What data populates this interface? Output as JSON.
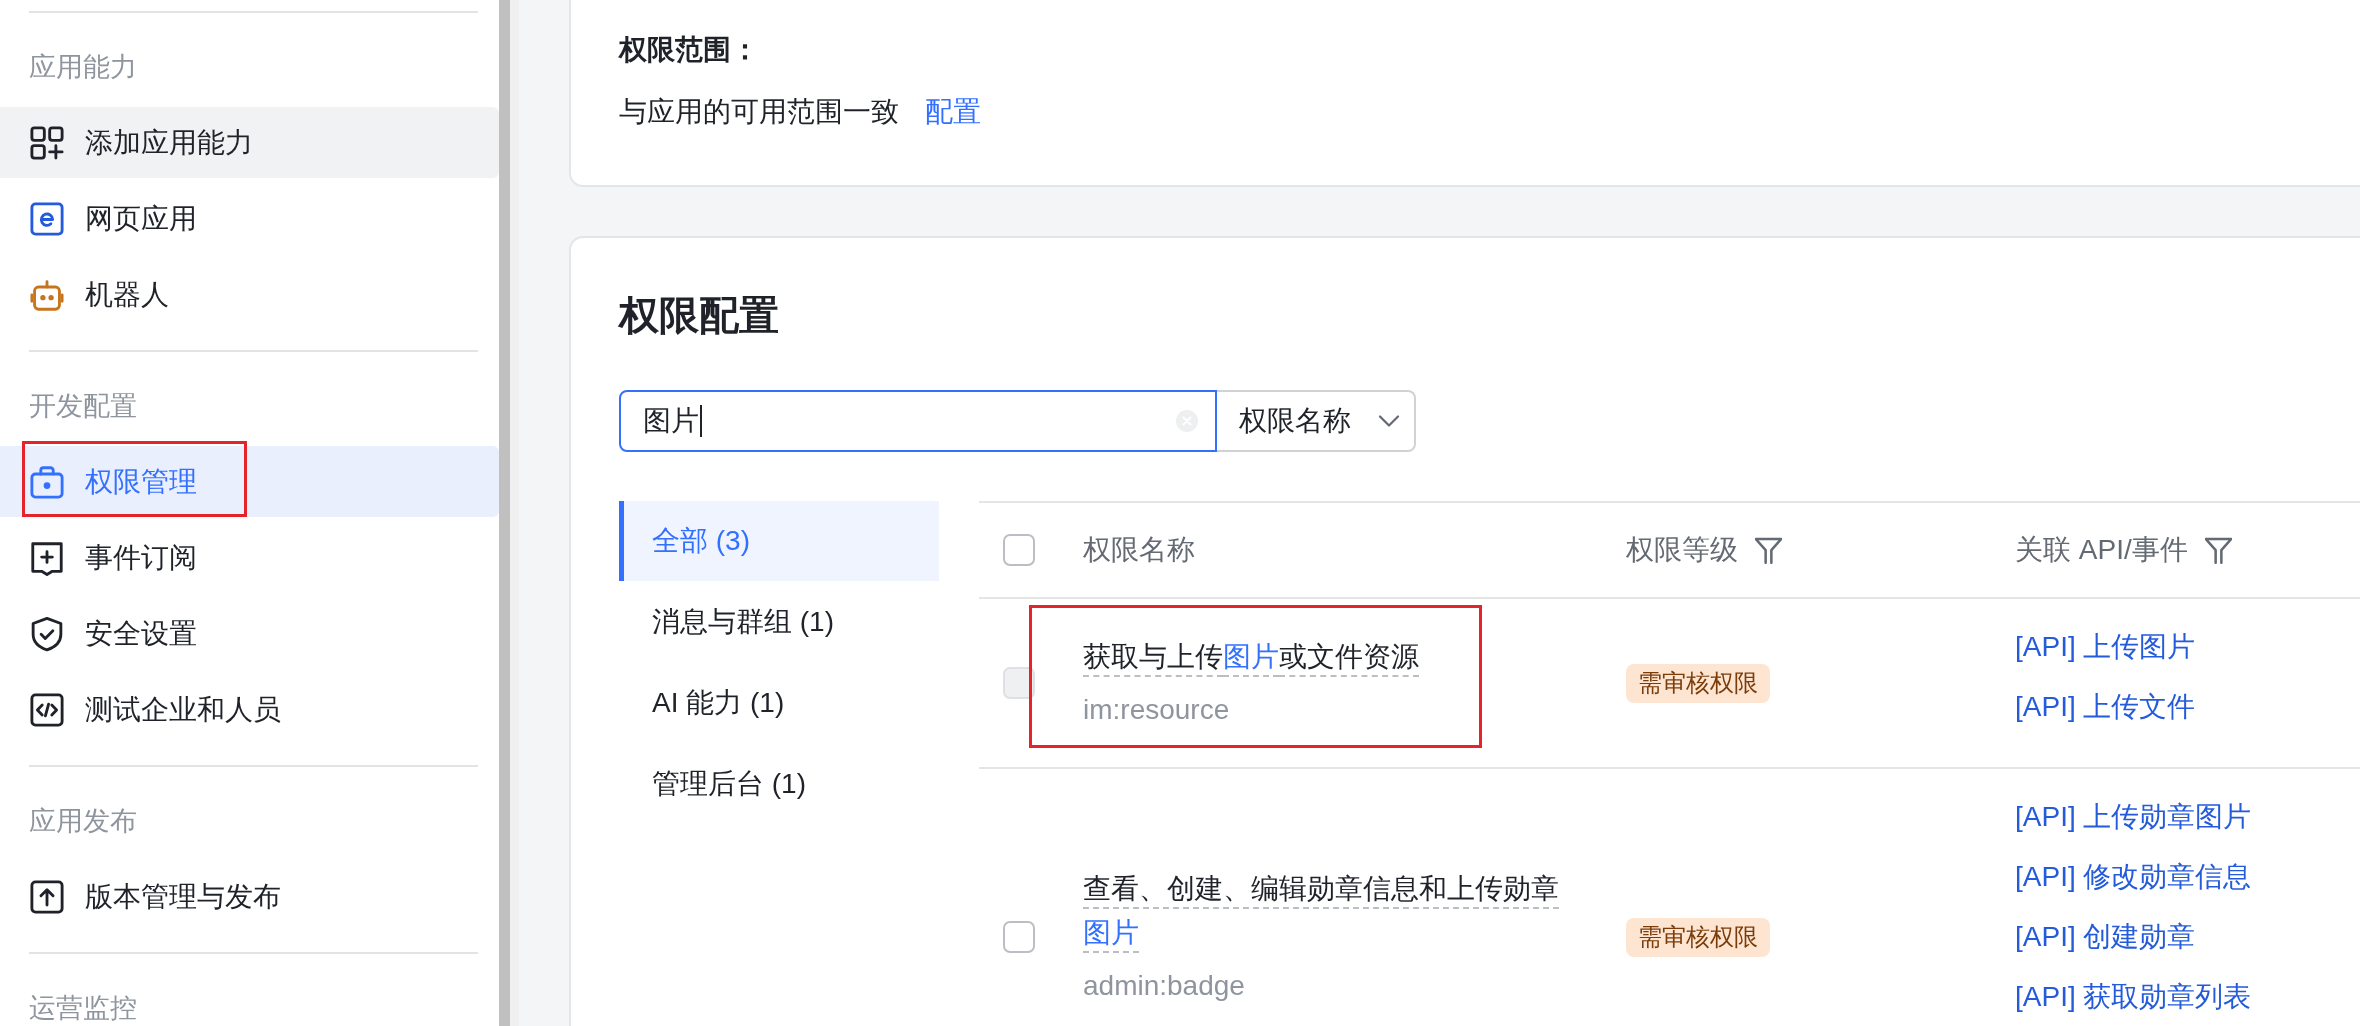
{
  "sidebar": {
    "sections": [
      {
        "title": "应用能力",
        "items": [
          {
            "label": "添加应用能力",
            "selected": false,
            "hovered": true,
            "annotated": false
          },
          {
            "label": "网页应用",
            "selected": false,
            "hovered": false,
            "annotated": false
          },
          {
            "label": "机器人",
            "selected": false,
            "hovered": false,
            "annotated": false
          }
        ]
      },
      {
        "title": "开发配置",
        "items": [
          {
            "label": "权限管理",
            "selected": true,
            "hovered": false,
            "annotated": true
          },
          {
            "label": "事件订阅",
            "selected": false,
            "hovered": false,
            "annotated": false
          },
          {
            "label": "安全设置",
            "selected": false,
            "hovered": false,
            "annotated": false
          },
          {
            "label": "测试企业和人员",
            "selected": false,
            "hovered": false,
            "annotated": false
          }
        ]
      },
      {
        "title": "应用发布",
        "items": [
          {
            "label": "版本管理与发布",
            "selected": false,
            "hovered": false,
            "annotated": false
          }
        ]
      },
      {
        "title": "运营监控"
      }
    ]
  },
  "scope_card": {
    "label": "权限范围：",
    "text": "与应用的可用范围一致",
    "link": "配置"
  },
  "permissions": {
    "title": "权限配置",
    "search": {
      "value": "图片",
      "focused": true
    },
    "search_scope": "权限名称",
    "categories": [
      {
        "label": "全部 (3)",
        "selected": true
      },
      {
        "label": "消息与群组 (1)",
        "selected": false
      },
      {
        "label": "AI 能力 (1)",
        "selected": false
      },
      {
        "label": "管理后台 (1)",
        "selected": false
      }
    ],
    "table": {
      "header_checkbox": {
        "checked": false
      },
      "columns": [
        {
          "label": "权限名称",
          "filter": false
        },
        {
          "label": "权限等级",
          "filter": true
        },
        {
          "label": "关联 API/事件",
          "filter": true
        }
      ],
      "rows": [
        {
          "checked": false,
          "disabled": true,
          "annotated": true,
          "name": [
            {
              "text": "获取与上传",
              "highlighted": false
            },
            {
              "text": "图片",
              "highlighted": true
            },
            {
              "text": "或文件资源",
              "highlighted": false
            }
          ],
          "scope": "im:resource",
          "grade": {
            "text": "需审核权限",
            "kind": "review"
          },
          "apis": [
            "[API] 上传图片",
            "[API] 上传文件"
          ]
        },
        {
          "checked": false,
          "disabled": false,
          "annotated": false,
          "name": [
            {
              "text": "查看、创建、编辑勋章信息和上传勋章",
              "highlighted": false
            },
            {
              "text": "图片",
              "highlighted": true
            }
          ],
          "scope": "admin:badge",
          "grade": {
            "text": "需审核权限",
            "kind": "review"
          },
          "apis": [
            "[API] 上传勋章图片",
            "[API] 修改勋章信息",
            "[API] 创建勋章",
            "[API] 获取勋章列表"
          ]
        }
      ]
    }
  }
}
